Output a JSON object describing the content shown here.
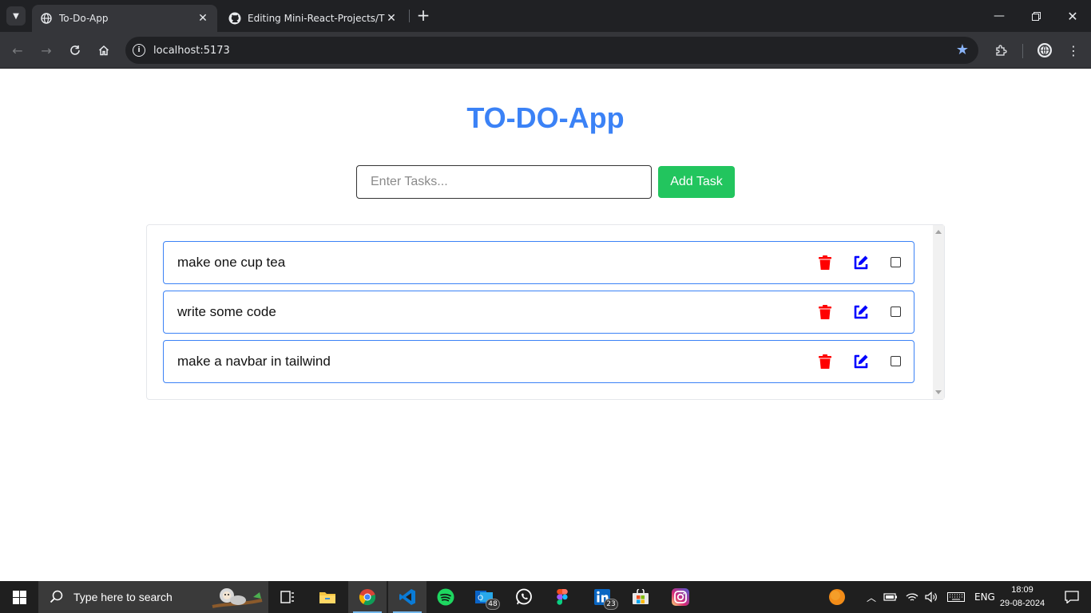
{
  "browser": {
    "tabs": [
      {
        "title": "To-Do-App",
        "active": true
      },
      {
        "title": "Editing Mini-React-Projects/TO",
        "active": false
      }
    ],
    "url": "localhost:5173"
  },
  "app": {
    "title": "TO-DO-App",
    "input_placeholder": "Enter Tasks...",
    "add_button_label": "Add Task",
    "tasks": [
      {
        "text": "make one cup tea"
      },
      {
        "text": "write some code"
      },
      {
        "text": "make a navbar in tailwind"
      }
    ]
  },
  "taskbar": {
    "search_placeholder": "Type here to search",
    "outlook_badge": "48",
    "linkedin_badge": "23",
    "language": "ENG",
    "time": "18:09",
    "date": "29-08-2024"
  },
  "colors": {
    "title": "#3b82f6",
    "add_button": "#22c55e",
    "delete_icon": "#ff0000",
    "edit_icon": "#0000ff"
  }
}
